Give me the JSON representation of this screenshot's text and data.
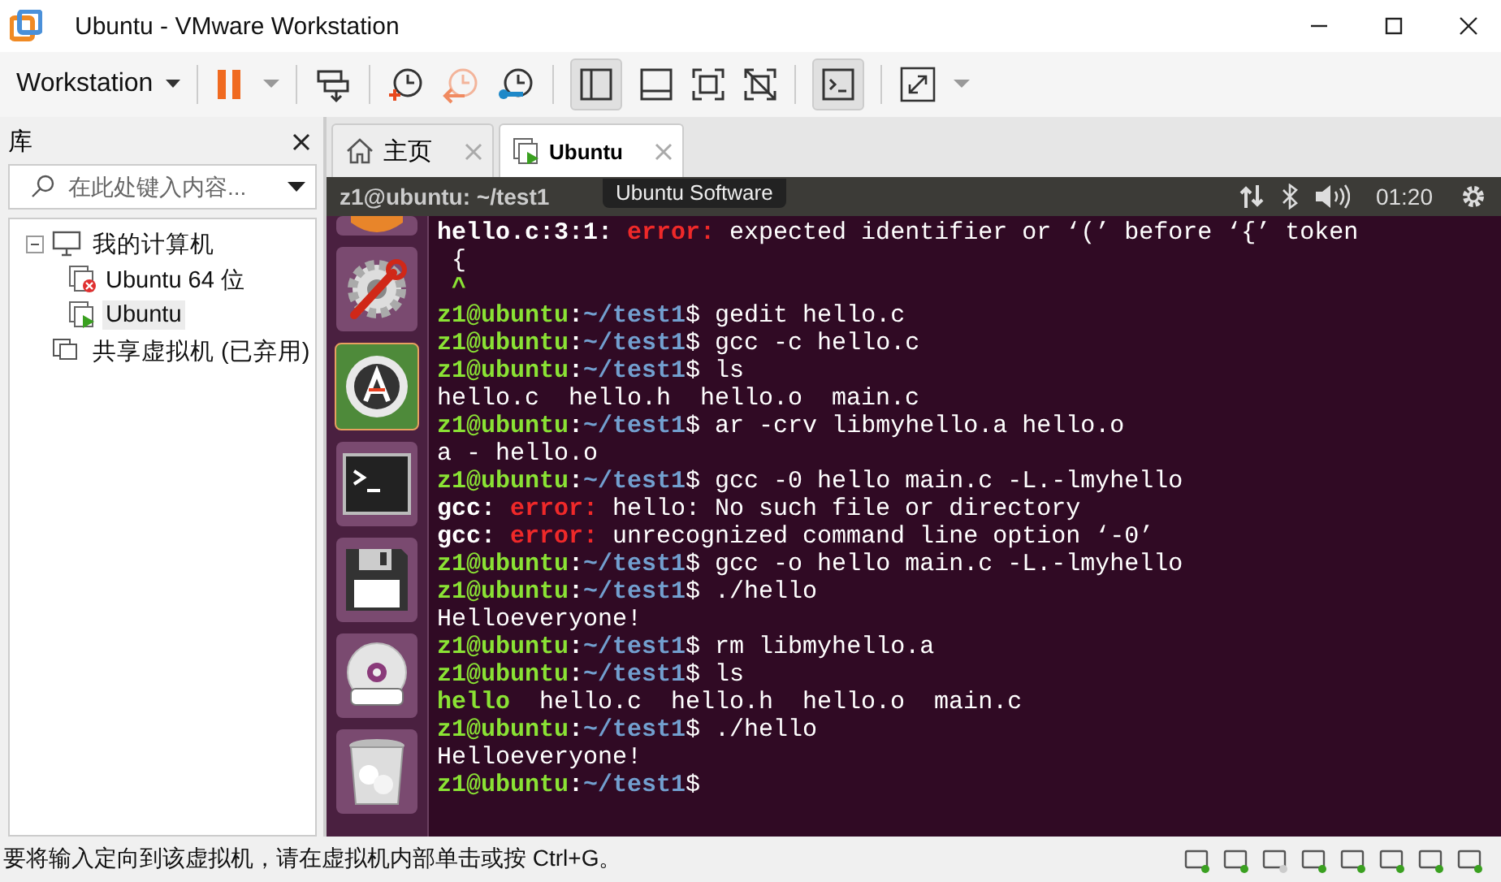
{
  "window": {
    "title": "Ubuntu - VMware Workstation"
  },
  "toolbar": {
    "menu_label": "Workstation"
  },
  "library": {
    "title": "库",
    "search": {
      "placeholder": "在此处键入内容..."
    },
    "tree": [
      {
        "label": "我的计算机",
        "kind": "computer",
        "expanded": true,
        "selected": false,
        "children": [
          {
            "label": "Ubuntu 64 位",
            "kind": "vm-stopped",
            "selected": false
          },
          {
            "label": "Ubuntu",
            "kind": "vm-running",
            "selected": true
          }
        ]
      },
      {
        "label": "共享虚拟机 (已弃用)",
        "kind": "shared",
        "selected": false
      }
    ]
  },
  "tabs": [
    {
      "label": "主页",
      "kind": "home",
      "selected": false
    },
    {
      "label": "Ubuntu",
      "kind": "vm",
      "selected": true
    }
  ],
  "guest": {
    "tooltip": "Ubuntu Software",
    "panel_title": "z1@ubuntu: ~/test1",
    "clock": "01:20",
    "terminal": [
      [
        {
          "kind": "label",
          "text": "hello.c:3:1: "
        },
        {
          "kind": "error",
          "text": "error: "
        },
        {
          "kind": "plain",
          "text": "expected identifier or ‘(’ before ‘{’ token"
        }
      ],
      [
        {
          "kind": "plain",
          "text": " {"
        }
      ],
      [
        {
          "kind": "exe",
          "text": " ^"
        }
      ],
      [
        {
          "kind": "user",
          "text": "z1@ubuntu"
        },
        {
          "kind": "label",
          "text": ":"
        },
        {
          "kind": "path",
          "text": "~/test1"
        },
        {
          "kind": "plain",
          "text": "$ gedit hello.c"
        }
      ],
      [
        {
          "kind": "user",
          "text": "z1@ubuntu"
        },
        {
          "kind": "label",
          "text": ":"
        },
        {
          "kind": "path",
          "text": "~/test1"
        },
        {
          "kind": "plain",
          "text": "$ gcc -c hello.c"
        }
      ],
      [
        {
          "kind": "user",
          "text": "z1@ubuntu"
        },
        {
          "kind": "label",
          "text": ":"
        },
        {
          "kind": "path",
          "text": "~/test1"
        },
        {
          "kind": "plain",
          "text": "$ ls"
        }
      ],
      [
        {
          "kind": "plain",
          "text": "hello.c  hello.h  hello.o  main.c"
        }
      ],
      [
        {
          "kind": "user",
          "text": "z1@ubuntu"
        },
        {
          "kind": "label",
          "text": ":"
        },
        {
          "kind": "path",
          "text": "~/test1"
        },
        {
          "kind": "plain",
          "text": "$ ar -crv libmyhello.a hello.o"
        }
      ],
      [
        {
          "kind": "plain",
          "text": "a - hello.o"
        }
      ],
      [
        {
          "kind": "user",
          "text": "z1@ubuntu"
        },
        {
          "kind": "label",
          "text": ":"
        },
        {
          "kind": "path",
          "text": "~/test1"
        },
        {
          "kind": "plain",
          "text": "$ gcc -0 hello main.c -L.-lmyhello"
        }
      ],
      [
        {
          "kind": "label",
          "text": "gcc: "
        },
        {
          "kind": "error",
          "text": "error: "
        },
        {
          "kind": "plain",
          "text": "hello: No such file or directory"
        }
      ],
      [
        {
          "kind": "label",
          "text": "gcc: "
        },
        {
          "kind": "error",
          "text": "error: "
        },
        {
          "kind": "plain",
          "text": "unrecognized command line option ‘-0’"
        }
      ],
      [
        {
          "kind": "user",
          "text": "z1@ubuntu"
        },
        {
          "kind": "label",
          "text": ":"
        },
        {
          "kind": "path",
          "text": "~/test1"
        },
        {
          "kind": "plain",
          "text": "$ gcc -o hello main.c -L.-lmyhello"
        }
      ],
      [
        {
          "kind": "user",
          "text": "z1@ubuntu"
        },
        {
          "kind": "label",
          "text": ":"
        },
        {
          "kind": "path",
          "text": "~/test1"
        },
        {
          "kind": "plain",
          "text": "$ ./hello"
        }
      ],
      [
        {
          "kind": "plain",
          "text": "Helloeveryone!"
        }
      ],
      [
        {
          "kind": "user",
          "text": "z1@ubuntu"
        },
        {
          "kind": "label",
          "text": ":"
        },
        {
          "kind": "path",
          "text": "~/test1"
        },
        {
          "kind": "plain",
          "text": "$ rm libmyhello.a"
        }
      ],
      [
        {
          "kind": "user",
          "text": "z1@ubuntu"
        },
        {
          "kind": "label",
          "text": ":"
        },
        {
          "kind": "path",
          "text": "~/test1"
        },
        {
          "kind": "plain",
          "text": "$ ls"
        }
      ],
      [
        {
          "kind": "exe",
          "text": "hello"
        },
        {
          "kind": "plain",
          "text": "  hello.c  hello.h  hello.o  main.c"
        }
      ],
      [
        {
          "kind": "user",
          "text": "z1@ubuntu"
        },
        {
          "kind": "label",
          "text": ":"
        },
        {
          "kind": "path",
          "text": "~/test1"
        },
        {
          "kind": "plain",
          "text": "$ ./hello"
        }
      ],
      [
        {
          "kind": "plain",
          "text": "Helloeveryone!"
        }
      ],
      [
        {
          "kind": "user",
          "text": "z1@ubuntu"
        },
        {
          "kind": "label",
          "text": ":"
        },
        {
          "kind": "path",
          "text": "~/test1"
        },
        {
          "kind": "plain",
          "text": "$"
        }
      ]
    ]
  },
  "status_bar": {
    "message": "要将输入定向到该虚拟机，请在虚拟机内部单击或按 Ctrl+G。"
  }
}
